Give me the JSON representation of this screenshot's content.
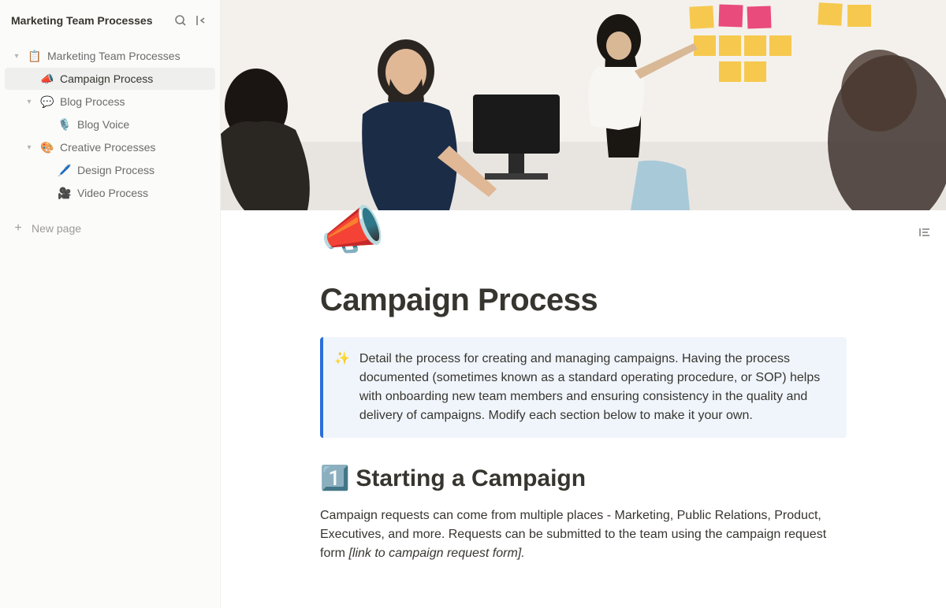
{
  "workspace": {
    "title": "Marketing Team Processes"
  },
  "sidebar": {
    "items": [
      {
        "icon": "📋",
        "label": "Marketing Team Processes",
        "depth": 0,
        "chevron": true,
        "active": false
      },
      {
        "icon": "📣",
        "label": "Campaign Process",
        "depth": 1,
        "chevron": false,
        "active": true
      },
      {
        "icon": "💬",
        "label": "Blog Process",
        "depth": 1,
        "chevron": true,
        "active": false
      },
      {
        "icon": "🎙️",
        "label": "Blog Voice",
        "depth": 2,
        "chevron": false,
        "active": false
      },
      {
        "icon": "🎨",
        "label": "Creative Processes",
        "depth": 1,
        "chevron": true,
        "active": false
      },
      {
        "icon": "🖊️",
        "label": "Design Process",
        "depth": 2,
        "chevron": false,
        "active": false
      },
      {
        "icon": "🎥",
        "label": "Video Process",
        "depth": 2,
        "chevron": false,
        "active": false
      }
    ],
    "new_page_label": "New page"
  },
  "page": {
    "icon": "📣",
    "title": "Campaign Process",
    "callout_icon": "✨",
    "callout_text": "Detail the process for creating and managing campaigns. Having the process documented (sometimes known as a standard operating procedure, or SOP) helps with onboarding new team members and ensuring consistency in the quality and delivery of campaigns. Modify each section below to make it your own.",
    "section1_num": "1️⃣",
    "section1_title": "Starting a Campaign",
    "body_para1": "Campaign requests can come from multiple places - Marketing, Public Relations, Product, Executives, and more. Requests can be submitted to the team using the campaign request form ",
    "body_para1_em": "[link to campaign request form]."
  }
}
